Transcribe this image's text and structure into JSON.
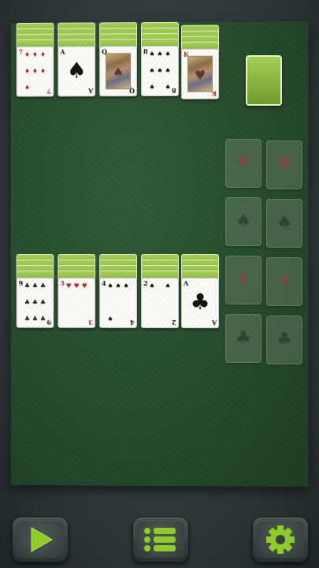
{
  "tableau_top": [
    {
      "rank": "7",
      "suit": "♦",
      "color": "red",
      "kind": "pips",
      "pips": 7
    },
    {
      "rank": "A",
      "suit": "♠",
      "color": "black",
      "kind": "ace"
    },
    {
      "rank": "Q",
      "suit": "♠",
      "color": "black",
      "kind": "face"
    },
    {
      "rank": "8",
      "suit": "♠",
      "color": "black",
      "kind": "pips",
      "pips": 8
    },
    {
      "rank": "K",
      "suit": "♥",
      "color": "red",
      "kind": "face"
    }
  ],
  "tableau_bottom": [
    {
      "rank": "9",
      "suit": "♣",
      "color": "black",
      "kind": "pips",
      "pips": 9
    },
    {
      "rank": "3",
      "suit": "♥",
      "color": "red",
      "kind": "pips",
      "pips": 3
    },
    {
      "rank": "4",
      "suit": "♠",
      "color": "black",
      "kind": "pips",
      "pips": 4
    },
    {
      "rank": "2",
      "suit": "♠",
      "color": "black",
      "kind": "pips",
      "pips": 2
    },
    {
      "rank": "A",
      "suit": "♣",
      "color": "black",
      "kind": "ace"
    }
  ],
  "foundations": [
    {
      "suit": "♥",
      "color": "red"
    },
    {
      "suit": "♥",
      "color": "red"
    },
    {
      "suit": "♠",
      "color": "black"
    },
    {
      "suit": "♠",
      "color": "black"
    },
    {
      "suit": "♦",
      "color": "red"
    },
    {
      "suit": "♦",
      "color": "red"
    },
    {
      "suit": "♣",
      "color": "black"
    },
    {
      "suit": "♣",
      "color": "black"
    }
  ],
  "toolbar": {
    "play_icon": "play-icon",
    "menu_icon": "menu-icon",
    "settings_icon": "gear-icon"
  },
  "colors": {
    "felt": "#254a2c",
    "card_back": "#8dbb45",
    "accent": "#8fcc2a"
  }
}
